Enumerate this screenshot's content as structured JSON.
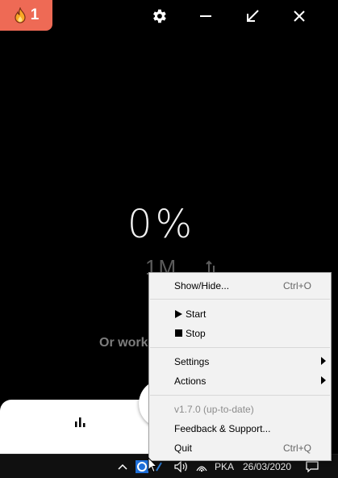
{
  "streak": {
    "count": "1",
    "icon": "flame-icon"
  },
  "window_controls": [
    "gear-icon",
    "minimize-icon",
    "shrink-icon",
    "close-icon"
  ],
  "progress": {
    "percent_text": "0%",
    "value": 0
  },
  "secondary": {
    "text": "1M"
  },
  "hint_text": "Or work",
  "context_menu": {
    "show_hide": {
      "label": "Show/Hide...",
      "shortcut": "Ctrl+O"
    },
    "start": {
      "label": "Start"
    },
    "stop": {
      "label": "Stop"
    },
    "settings": {
      "label": "Settings"
    },
    "actions": {
      "label": "Actions"
    },
    "version": {
      "label": "v1.7.0 (up-to-date)"
    },
    "feedback": {
      "label": "Feedback & Support..."
    },
    "quit": {
      "label": "Quit",
      "shortcut": "Ctrl+Q"
    }
  },
  "taskbar": {
    "language": "PKA",
    "date": "26/03/2020"
  },
  "colors": {
    "accent": "#ee6a55",
    "background": "#000000",
    "menu_bg": "#f2f2f2"
  }
}
